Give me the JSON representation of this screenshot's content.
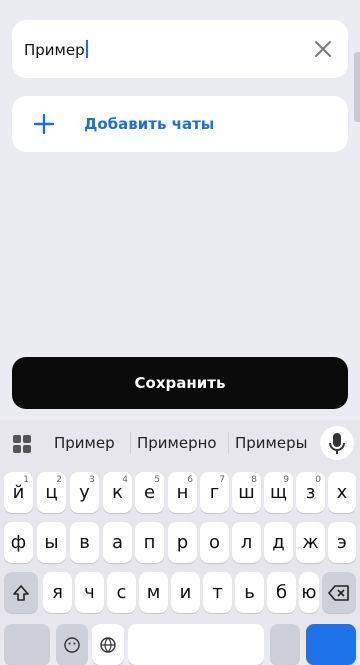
{
  "name_field": {
    "value": "Пример"
  },
  "add_chats": {
    "label": "Добавить чаты"
  },
  "save_button": {
    "label": "Сохранить"
  },
  "keyboard": {
    "suggestions": [
      "Пример",
      "Примерно",
      "Примеры"
    ],
    "row1": [
      {
        "char": "й",
        "hint": "1"
      },
      {
        "char": "ц",
        "hint": "2"
      },
      {
        "char": "у",
        "hint": "3"
      },
      {
        "char": "к",
        "hint": "4"
      },
      {
        "char": "е",
        "hint": "5"
      },
      {
        "char": "н",
        "hint": "6"
      },
      {
        "char": "г",
        "hint": "7"
      },
      {
        "char": "ш",
        "hint": "8"
      },
      {
        "char": "щ",
        "hint": "9"
      },
      {
        "char": "з",
        "hint": "0"
      },
      {
        "char": "х",
        "hint": ""
      }
    ],
    "row2": [
      "ф",
      "ы",
      "в",
      "а",
      "п",
      "р",
      "о",
      "л",
      "д",
      "ж",
      "э"
    ],
    "row3": [
      "я",
      "ч",
      "с",
      "м",
      "и",
      "т",
      "ь",
      "б",
      "ю"
    ]
  },
  "colors": {
    "accent": "#1e6fd8",
    "save_bg": "#0b0b0b",
    "page_bg": "#ebebf2"
  }
}
